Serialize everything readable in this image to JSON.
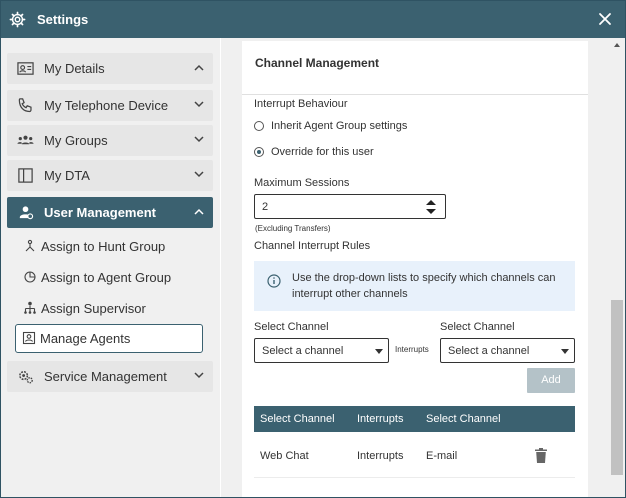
{
  "titlebar": {
    "title": "Settings"
  },
  "sidebar": {
    "items": [
      {
        "label": "My Details"
      },
      {
        "label": "My Telephone Device"
      },
      {
        "label": "My Groups"
      },
      {
        "label": "My DTA"
      },
      {
        "label": "User Management"
      },
      {
        "label": "Service Management"
      }
    ],
    "sub_items": [
      {
        "label": "Assign to Hunt Group"
      },
      {
        "label": "Assign to Agent Group"
      },
      {
        "label": "Assign Supervisor"
      },
      {
        "label": "Manage Agents"
      }
    ]
  },
  "card": {
    "title": "Channel Management",
    "interrupt_behaviour_label": "Interrupt Behaviour",
    "radio_inherit": "Inherit Agent Group settings",
    "radio_override": "Override for this user",
    "max_sessions_label": "Maximum Sessions",
    "max_sessions_value": "2",
    "excluding_note": "(Excluding Transfers)",
    "rules_label": "Channel Interrupt Rules",
    "info_text": "Use the drop-down lists to specify which channels can interrupt other channels",
    "select_channel_label_1": "Select Channel",
    "select_channel_label_2": "Select Channel",
    "select_placeholder_1": "Select a channel",
    "select_placeholder_2": "Select a channel",
    "interrupts_mid": "Interrupts",
    "add_label": "Add",
    "table": {
      "headers": [
        "Select Channel",
        "Interrupts",
        "Select Channel"
      ],
      "rows": [
        [
          "Web Chat",
          "Interrupts",
          "E-mail"
        ]
      ]
    }
  },
  "colors": {
    "accent": "#3b6170",
    "sidebar_bg": "#f0f0f0",
    "info_bg": "#e8f1fb"
  }
}
